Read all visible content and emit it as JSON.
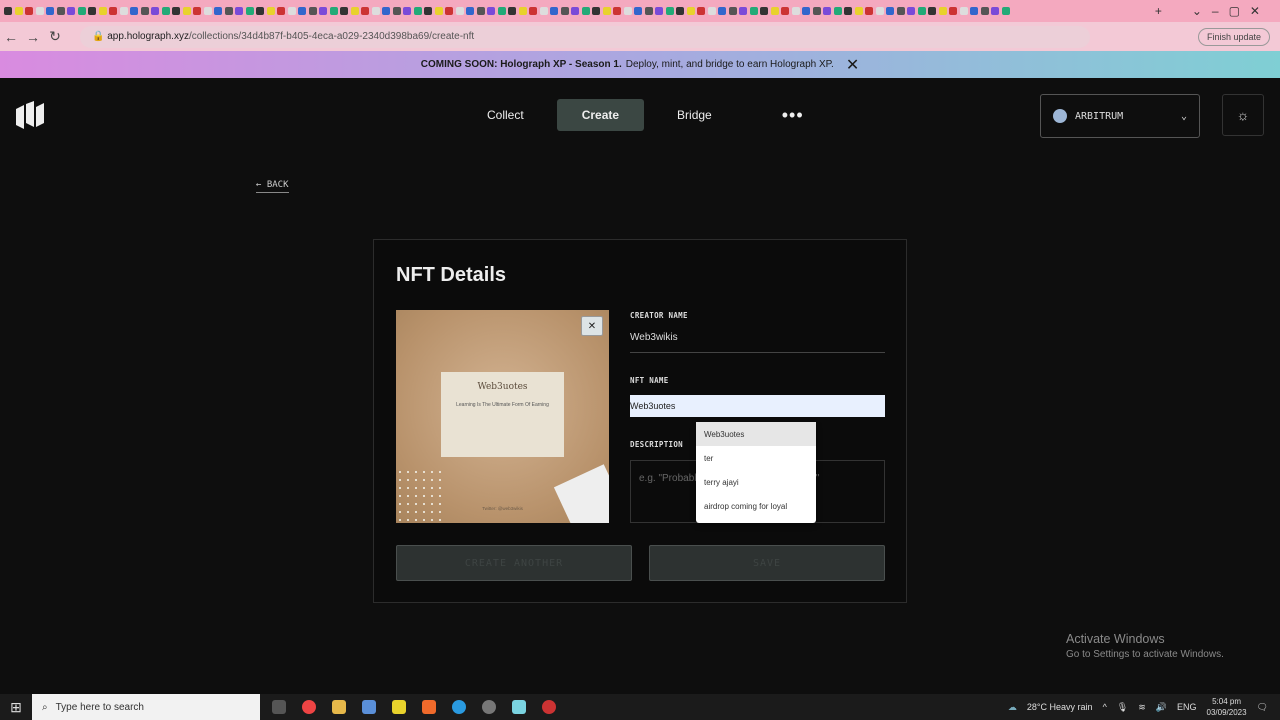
{
  "browser": {
    "url_host": "app.holograph.xyz",
    "url_path": "/collections/34d4b87f-b405-4eca-a029-2340d398ba69/create-nft",
    "finish_update": "Finish update",
    "tab_count": 96
  },
  "banner": {
    "bold": "COMING SOON: Holograph XP - Season 1.",
    "text": "Deploy, mint, and bridge to earn Holograph XP."
  },
  "nav": {
    "items": [
      "Collect",
      "Create",
      "Bridge"
    ],
    "more": "•••",
    "chain": "ARBITRUM",
    "back": "BACK"
  },
  "form": {
    "title": "NFT Details",
    "creator_label": "CREATOR NAME",
    "creator_value": "Web3wikis",
    "nft_label": "NFT NAME",
    "nft_value": "Web3uotes",
    "desc_label": "DESCRIPTION",
    "desc_placeholder": "e.g. \"Probably the best NFT in the world\"",
    "create_another": "CREATE ANOTHER",
    "save": "SAVE"
  },
  "preview": {
    "title": "Web3uotes",
    "quote": "Learning Is The Ultimate Form Of Earning",
    "handle": "Twitter: @web3wikis"
  },
  "autocomplete": [
    "Web3uotes",
    "ter",
    "terry ajayi",
    "airdrop coming for loyal"
  ],
  "activation": {
    "title": "Activate Windows",
    "subtitle": "Go to Settings to activate Windows."
  },
  "taskbar": {
    "search": "Type here to search",
    "weather": "28°C  Heavy rain",
    "lang": "ENG",
    "time": "5:04 pm",
    "date": "03/09/2023"
  }
}
